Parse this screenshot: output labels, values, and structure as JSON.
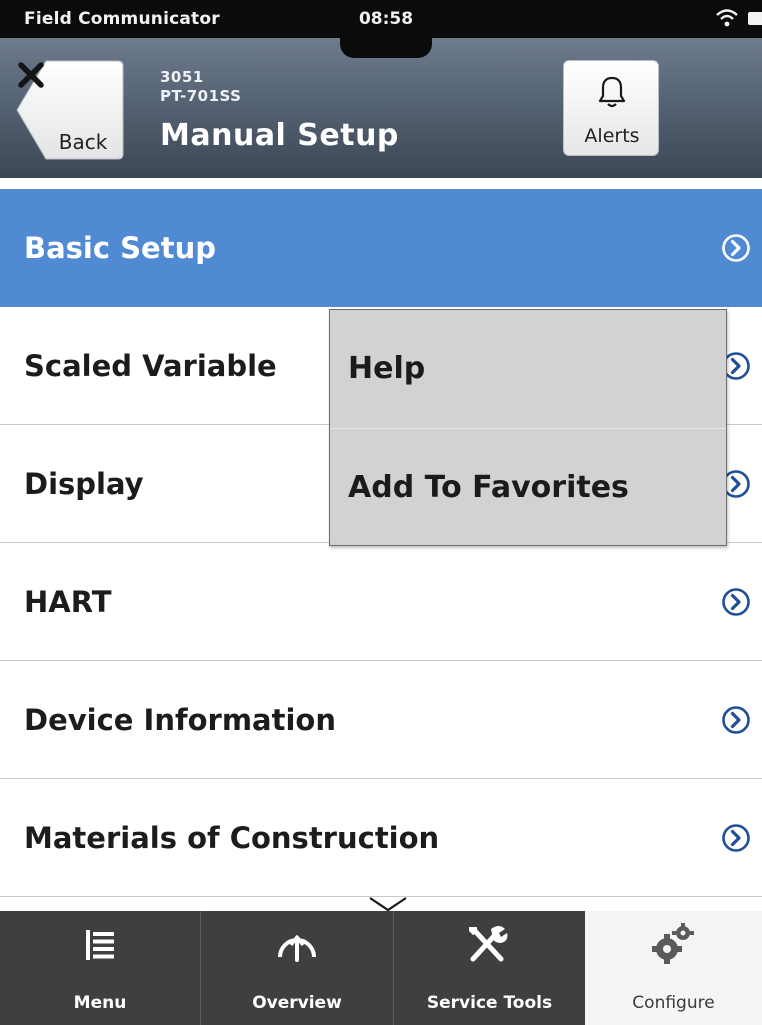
{
  "status_bar": {
    "app_name": "Field Communicator",
    "time": "08:58"
  },
  "header": {
    "back_label": "Back",
    "device_model": "3051",
    "device_tag": "PT-701SS",
    "title": "Manual Setup",
    "alerts_label": "Alerts"
  },
  "menu": {
    "items": [
      {
        "label": "Basic Setup",
        "selected": true,
        "icon": "chevron-circle-right-icon"
      },
      {
        "label": "Scaled Variable",
        "icon": "chevron-circle-right-icon"
      },
      {
        "label": "Display",
        "icon": "chevron-circle-right-icon"
      },
      {
        "label": "HART",
        "icon": "chevron-circle-right-icon"
      },
      {
        "label": "Device Information",
        "icon": "chevron-circle-right-icon"
      },
      {
        "label": "Materials of Construction",
        "icon": "chevron-circle-right-icon"
      }
    ]
  },
  "popup": {
    "items": [
      {
        "label": "Help"
      },
      {
        "label": "Add To Favorites"
      }
    ]
  },
  "tabs": {
    "items": [
      {
        "label": "Menu",
        "icon": "list-icon"
      },
      {
        "label": "Overview",
        "icon": "gauge-icon"
      },
      {
        "label": "Service Tools",
        "icon": "tools-icon"
      },
      {
        "label": "Configure",
        "icon": "gears-icon",
        "active": true
      }
    ]
  },
  "colors": {
    "selected_row": "#4f8ad3",
    "chevron": "#1f4f9a",
    "header_top": "#6e7b8c",
    "header_bottom": "#3c4755",
    "tab_dark": "#3f3f3f"
  }
}
